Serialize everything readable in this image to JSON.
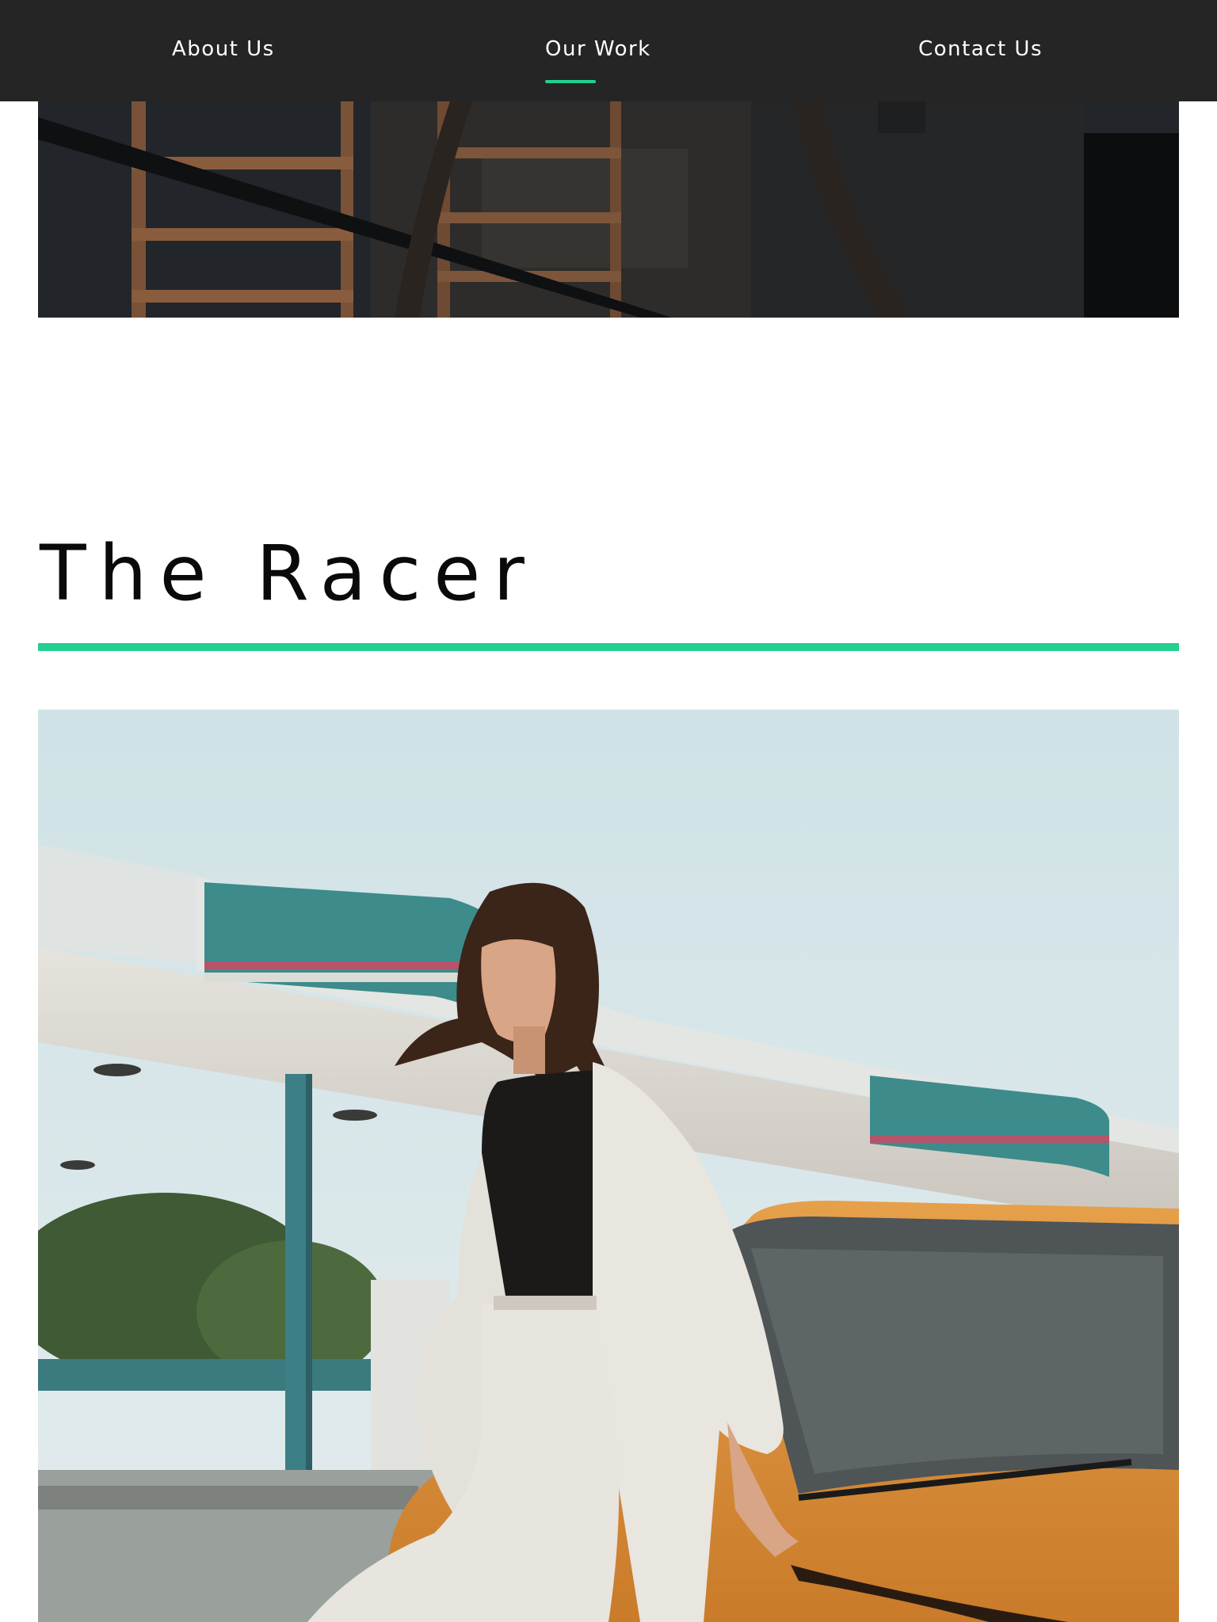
{
  "nav": {
    "items": [
      {
        "label": "About Us",
        "active": false
      },
      {
        "label": "Our Work",
        "active": true
      },
      {
        "label": "Contact Us",
        "active": false
      }
    ],
    "background": "#252525",
    "accent": "#23d08f"
  },
  "section": {
    "title": "The Racer",
    "accent": "#23d08f"
  }
}
